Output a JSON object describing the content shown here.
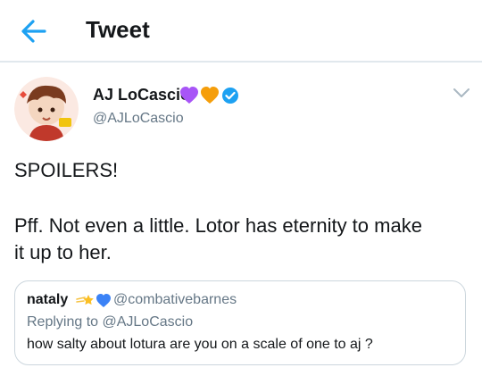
{
  "header": {
    "title": "Tweet",
    "back_icon": "arrow-left-icon",
    "accent_color": "#1da1f2"
  },
  "tweet": {
    "author_name": "AJ LoCascio",
    "author_emoji": [
      "purple-heart",
      "orange-heart"
    ],
    "verified_icon": "verified-badge-icon",
    "handle": "@AJLoCascio",
    "more_icon": "chevron-down-icon",
    "text_line1": "SPOILERS!",
    "text_line2": "Pff. Not even a little. Lotor has eternity to make",
    "text_line3": "it up to her."
  },
  "quote": {
    "name": "nataly",
    "emoji": [
      "shooting-star",
      "blue-heart"
    ],
    "handle": "@combativebarnes",
    "reply_line": "Replying to @AJLoCascio",
    "text": "how salty about lotura are you on a scale of one to aj ?"
  }
}
